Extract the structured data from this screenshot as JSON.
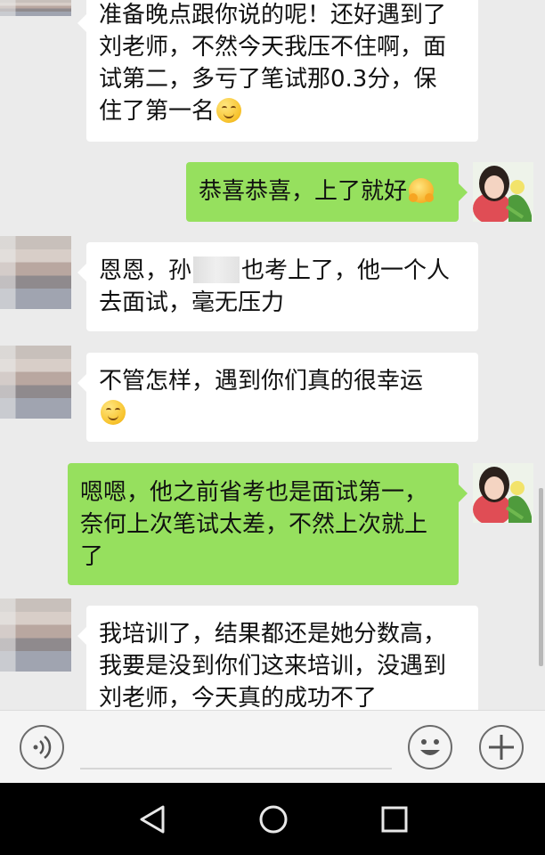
{
  "messages": [
    {
      "side": "in",
      "lines": [
        "准备晚点跟你说的呢！还好遇到了",
        "刘老师，不然今天我压不住啊，面",
        "试第二，多亏了笔试那0.3分，保",
        "住了第一名"
      ],
      "emoji": "smile-emoji"
    },
    {
      "side": "out",
      "lines": [
        "恭喜恭喜，上了就好"
      ],
      "emoji": "hug-emoji"
    },
    {
      "side": "in",
      "lines_a": [
        "恩恩，孙",
        "也考上了，他一个人"
      ],
      "lines": [
        "去面试，毫无压力"
      ]
    },
    {
      "side": "in",
      "lines": [
        "不管怎样，遇到你们真的很幸运"
      ],
      "emoji": "smile-emoji"
    },
    {
      "side": "out",
      "lines": [
        "嗯嗯，他之前省考也是面试第一，",
        "奈何上次笔试太差，不然上次就上",
        "了"
      ]
    },
    {
      "side": "in",
      "lines": [
        "我培训了，结果都还是她分数高，",
        "我要是没到你们这来培训，没遇到",
        "刘老师，今天真的成功不了"
      ]
    }
  ],
  "icons": {
    "voice": "voice-icon",
    "emoji": "emoji-face-icon",
    "more": "plus-icon",
    "back": "back-triangle-icon",
    "home": "home-circle-icon",
    "recents": "recents-square-icon"
  },
  "colors": {
    "chat_background": "#ebebeb",
    "incoming_bubble": "#ffffff",
    "outgoing_bubble": "#96e05e",
    "nav_bar": "#000000"
  }
}
